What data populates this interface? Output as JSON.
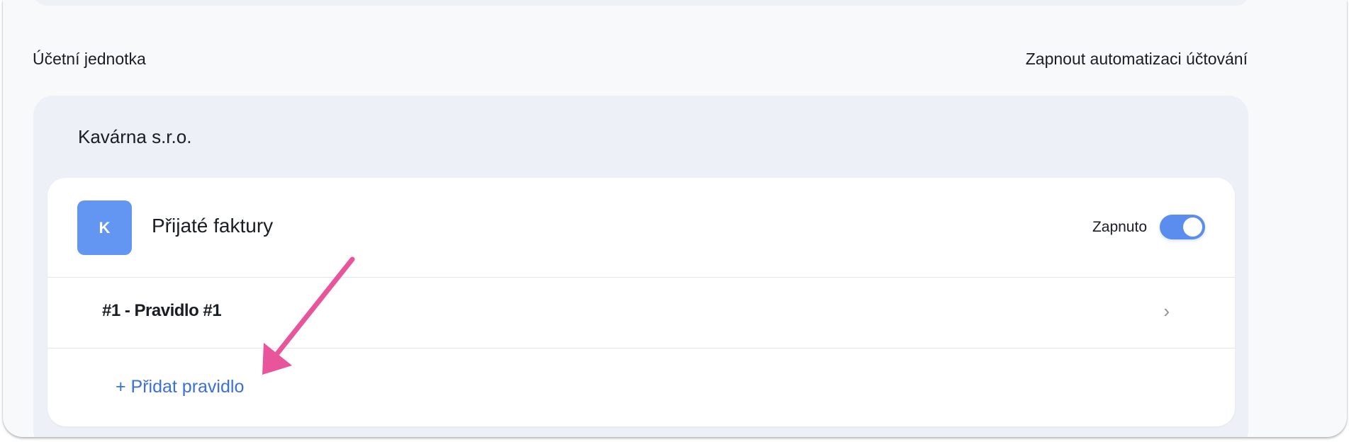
{
  "header": {
    "left_label": "Účetní jednotka",
    "right_label": "Zapnout automatizaci účtování"
  },
  "unit": {
    "name": "Kavárna s.r.o.",
    "card": {
      "avatar_letter": "K",
      "title": "Přijaté faktury",
      "toggle_label": "Zapnuto",
      "toggle_on": true,
      "rules": [
        {
          "label": "#1 - Pravidlo #1"
        }
      ],
      "add_rule_label": "+ Přidat pravidlo"
    }
  },
  "colors": {
    "accent": "#5b8def",
    "avatar": "#6395f2",
    "link": "#3a6fe0",
    "annotation_arrow": "#e8559b"
  },
  "icons": {
    "rule_chevron": "chevron-right-icon",
    "annotation": "annotation-arrow"
  }
}
